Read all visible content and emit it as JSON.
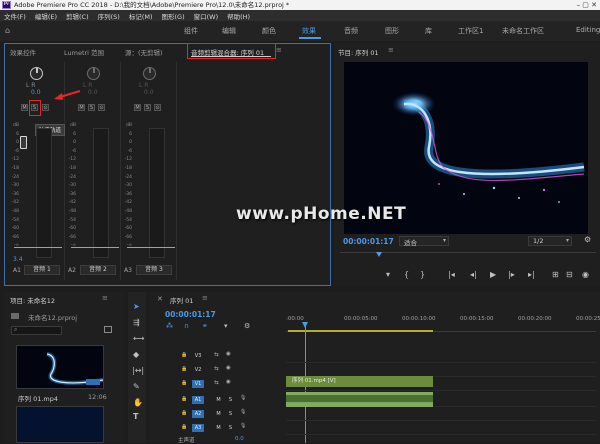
{
  "window": {
    "title": "Adobe Premiere Pro CC 2018 - D:\\我的文档\\Adobe\\Premiere Pro\\12.0\\未命名12.prproj *",
    "icon_text": "Pr"
  },
  "menu": [
    "文件(F)",
    "编辑(E)",
    "剪辑(C)",
    "序列(S)",
    "标记(M)",
    "图形(G)",
    "窗口(W)",
    "帮助(H)"
  ],
  "workspaces": [
    {
      "label": "组件",
      "active": false
    },
    {
      "label": "编辑",
      "active": false
    },
    {
      "label": "颜色",
      "active": false
    },
    {
      "label": "效果",
      "active": true
    },
    {
      "label": "音频",
      "active": false
    },
    {
      "label": "图形",
      "active": false
    },
    {
      "label": "库",
      "active": false
    },
    {
      "label": "工作区1",
      "active": false
    },
    {
      "label": "未命名工作区",
      "active": false
    },
    {
      "label": "Editing",
      "active": false
    }
  ],
  "mixer": {
    "tabs": [
      "效果控件",
      "Lumetri 范围",
      "源：(无剪辑)",
      "音频剪辑混合器: 序列 01"
    ],
    "channels": [
      {
        "lr": "L     R",
        "value": "0.0",
        "msr": [
          "M",
          "S",
          "⊙"
        ],
        "track_id": "A1",
        "track_name": "音频 1"
      },
      {
        "lr": "L     R",
        "value": "0.0",
        "msr": [
          "M",
          "S",
          "⊙"
        ],
        "track_id": "A2",
        "track_name": "音频 2"
      },
      {
        "lr": "L     R",
        "value": "0.0",
        "msr": [
          "M",
          "S",
          "⊙"
        ],
        "track_id": "A3",
        "track_name": "音频 3"
      }
    ],
    "scale": [
      "dB",
      "6",
      "0",
      "-6",
      "-12",
      "-18",
      "-24",
      "-30",
      "-36",
      "-42",
      "-48",
      "-54",
      "-60",
      "-66",
      "-∞"
    ],
    "tooltip": "独奏轨道",
    "volume_readout": "3.4"
  },
  "program": {
    "title": "节目: 序列 01",
    "timecode": "00:00:01:17",
    "fit": "适合",
    "resolution": "1/2",
    "watermark": "www.pHome.NET"
  },
  "project": {
    "title": "项目: 未命名12",
    "file": "未命名12.prproj",
    "clip_name": "序列 01.mp4",
    "clip_duration": "12:06"
  },
  "timeline": {
    "tab": "序列 01",
    "timecode": "00:00:01:17",
    "ruler": [
      ":00:00",
      "00:00:05:00",
      "00:00:10:00",
      "00:00:15:00",
      "00:00:20:00",
      "00:00:25"
    ],
    "tracks": [
      {
        "id": "V3",
        "type": "video"
      },
      {
        "id": "V2",
        "type": "video"
      },
      {
        "id": "V1",
        "type": "video",
        "clip": "序列 01.mp4 [V]"
      },
      {
        "id": "A1",
        "type": "audio",
        "msr": [
          "M",
          "S"
        ]
      },
      {
        "id": "A2",
        "type": "audio",
        "msr": [
          "M",
          "S"
        ]
      },
      {
        "id": "A3",
        "type": "audio",
        "msr": [
          "M",
          "S"
        ]
      }
    ],
    "master": "主声道",
    "master_value": "0.0"
  },
  "colors": {
    "accent": "#4d9ae6",
    "highlight": "#e8262b",
    "clip_video": "#6c8b3b"
  }
}
